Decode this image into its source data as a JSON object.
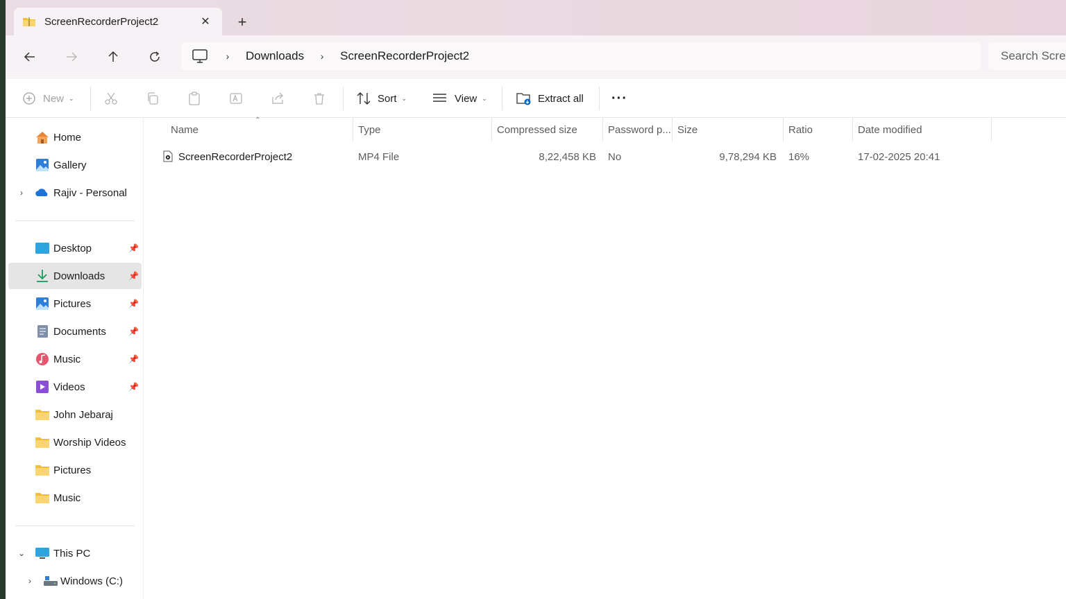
{
  "window": {
    "tab_title": "ScreenRecorderProject2",
    "close_glyph": "✕",
    "newtab_glyph": "+"
  },
  "navbar": {
    "breadcrumbs": [
      "Downloads",
      "ScreenRecorderProject2"
    ],
    "search_text": "Search Scree"
  },
  "commands": {
    "new_label": "New",
    "sort_label": "Sort",
    "view_label": "View",
    "extract_label": "Extract all",
    "more_glyph": "···"
  },
  "sidebar": {
    "top": [
      {
        "label": "Home",
        "icon": "home-icon"
      },
      {
        "label": "Gallery",
        "icon": "gallery-icon"
      },
      {
        "label": "Rajiv - Personal",
        "icon": "onedrive-icon"
      }
    ],
    "quick_access": [
      {
        "label": "Desktop",
        "icon": "desktop-icon"
      },
      {
        "label": "Downloads",
        "icon": "downloads-icon"
      },
      {
        "label": "Pictures",
        "icon": "pictures-icon"
      },
      {
        "label": "Documents",
        "icon": "documents-icon"
      },
      {
        "label": "Music",
        "icon": "music-icon"
      },
      {
        "label": "Videos",
        "icon": "videos-icon"
      },
      {
        "label": "John Jebaraj",
        "icon": "folder-icon"
      },
      {
        "label": "Worship Videos",
        "icon": "folder-icon"
      },
      {
        "label": "Pictures",
        "icon": "folder-icon"
      },
      {
        "label": "Music",
        "icon": "folder-icon"
      }
    ],
    "this_pc": {
      "label": "This PC",
      "icon": "this-pc-icon"
    },
    "drive": {
      "label": "Windows (C:)",
      "icon": "drive-icon"
    }
  },
  "columns": {
    "name": "Name",
    "type": "Type",
    "compressed": "Compressed size",
    "password": "Password p...",
    "size": "Size",
    "ratio": "Ratio",
    "date": "Date modified"
  },
  "files": [
    {
      "name": "ScreenRecorderProject2",
      "type": "MP4 File",
      "compressed": "8,22,458 KB",
      "password": "No",
      "size": "9,78,294 KB",
      "ratio": "16%",
      "date": "17-02-2025 20:41"
    }
  ],
  "colors": {
    "accent": "#0067c0",
    "folder": "#f7c948",
    "selected": "#e5e5e5"
  }
}
